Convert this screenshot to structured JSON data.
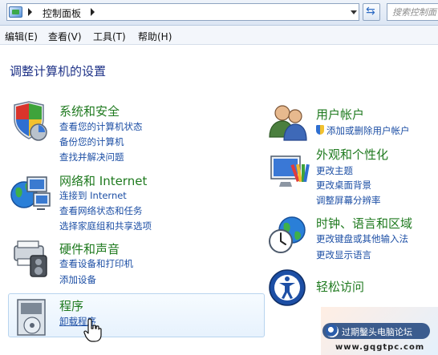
{
  "address_bar": {
    "breadcrumb": "控制面板",
    "search_placeholder": "搜索控制面"
  },
  "menu": [
    {
      "label": "编辑(E)"
    },
    {
      "label": "查看(V)"
    },
    {
      "label": "工具(T)"
    },
    {
      "label": "帮助(H)"
    }
  ],
  "heading": "调整计算机的设置",
  "categories": {
    "system_security": {
      "title": "系统和安全",
      "links": [
        "查看您的计算机状态",
        "备份您的计算机",
        "查找并解决问题"
      ]
    },
    "network": {
      "title": "网络和 Internet",
      "links": [
        "连接到 Internet",
        "查看网络状态和任务",
        "选择家庭组和共享选项"
      ]
    },
    "hardware_sound": {
      "title": "硬件和声音",
      "links": [
        "查看设备和打印机",
        "添加设备"
      ]
    },
    "programs": {
      "title": "程序",
      "links": [
        "卸载程序"
      ]
    },
    "user_accounts": {
      "title": "用户帐户",
      "links": [
        "添加或删除用户帐户"
      ]
    },
    "appearance": {
      "title": "外观和个性化",
      "links": [
        "更改主题",
        "更改桌面背景",
        "调整屏幕分辨率"
      ]
    },
    "clock_region": {
      "title": "时钟、语言和区域",
      "links": [
        "更改键盘或其他输入法",
        "更改显示语言"
      ]
    },
    "ease_access": {
      "title": "轻松访问",
      "links": []
    }
  },
  "watermark": {
    "text": "过期鑿头电脑论坛",
    "url": "www.gqgtpc.com"
  }
}
